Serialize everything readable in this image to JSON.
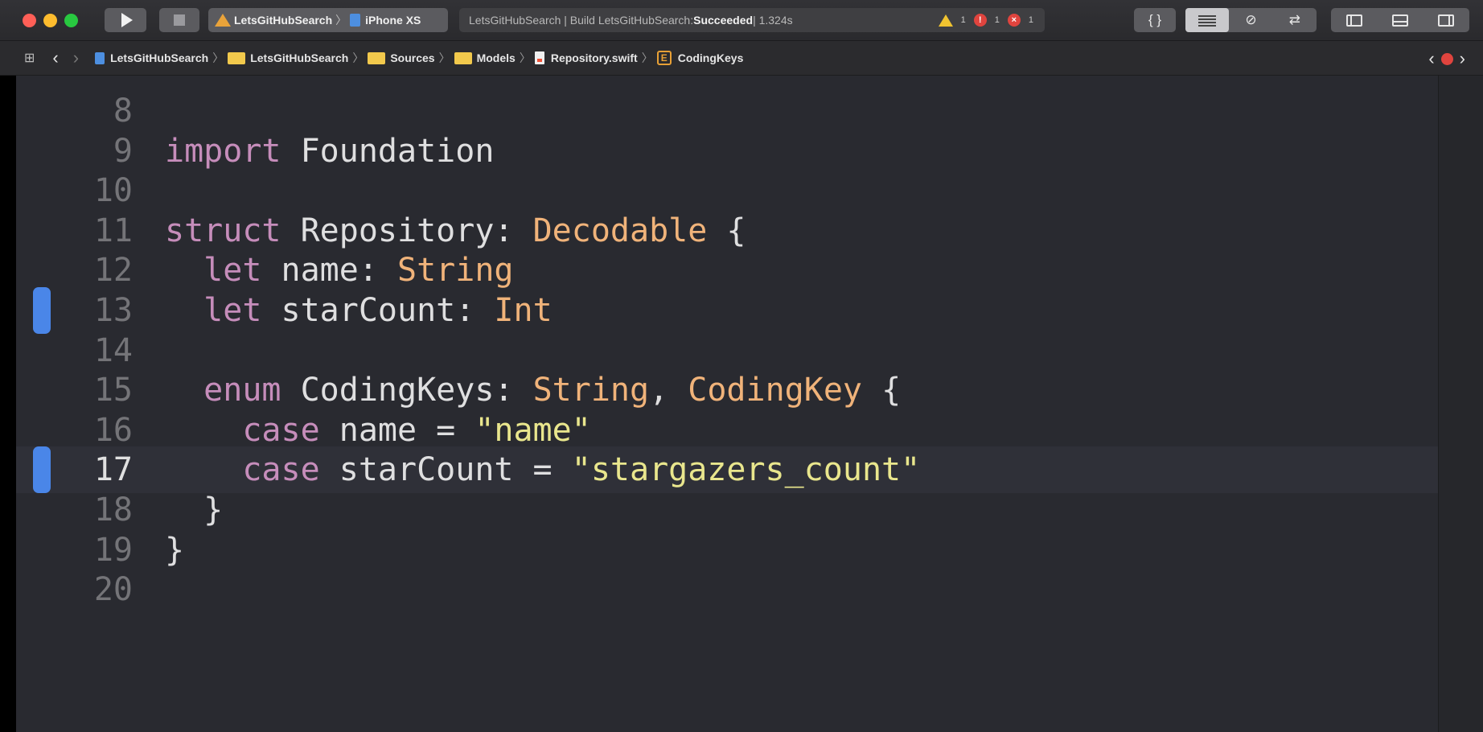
{
  "toolbar": {
    "scheme": {
      "target": "LetsGitHubSearch",
      "device": "iPhone XS"
    },
    "activity": {
      "prefix": "LetsGitHubSearch | Build LetsGitHubSearch: ",
      "status": "Succeeded",
      "suffix": " | 1.324s",
      "warning_count": "1",
      "issue_count": "1",
      "error_count": "1"
    },
    "braces_label": "{ }"
  },
  "jumpbar": {
    "crumbs": [
      "LetsGitHubSearch",
      "LetsGitHubSearch",
      "Sources",
      "Models",
      "Repository.swift",
      "CodingKeys"
    ],
    "enum_badge": "E"
  },
  "editor": {
    "lines": [
      {
        "num": "8",
        "tokens": []
      },
      {
        "num": "9",
        "tokens": [
          [
            "kw",
            "import"
          ],
          [
            "pl",
            " Foundation"
          ]
        ]
      },
      {
        "num": "10",
        "tokens": []
      },
      {
        "num": "11",
        "tokens": [
          [
            "kw",
            "struct"
          ],
          [
            "pl",
            " Repository: "
          ],
          [
            "ty",
            "Decodable"
          ],
          [
            "pl",
            " {"
          ]
        ]
      },
      {
        "num": "12",
        "tokens": [
          [
            "pl",
            "  "
          ],
          [
            "kw",
            "let"
          ],
          [
            "pl",
            " name: "
          ],
          [
            "ty",
            "String"
          ]
        ]
      },
      {
        "num": "13",
        "tokens": [
          [
            "pl",
            "  "
          ],
          [
            "kw",
            "let"
          ],
          [
            "pl",
            " starCount: "
          ],
          [
            "ty",
            "Int"
          ]
        ],
        "changed": true
      },
      {
        "num": "14",
        "tokens": []
      },
      {
        "num": "15",
        "tokens": [
          [
            "pl",
            "  "
          ],
          [
            "kw",
            "enum"
          ],
          [
            "pl",
            " CodingKeys: "
          ],
          [
            "ty",
            "String"
          ],
          [
            "pl",
            ", "
          ],
          [
            "ty",
            "CodingKey"
          ],
          [
            "pl",
            " {"
          ]
        ]
      },
      {
        "num": "16",
        "tokens": [
          [
            "pl",
            "    "
          ],
          [
            "kw",
            "case"
          ],
          [
            "pl",
            " name = "
          ],
          [
            "str",
            "\"name\""
          ]
        ]
      },
      {
        "num": "17",
        "tokens": [
          [
            "pl",
            "    "
          ],
          [
            "kw",
            "case"
          ],
          [
            "pl",
            " starCount = "
          ],
          [
            "str",
            "\"stargazers_count\""
          ]
        ],
        "changed": true,
        "current": true
      },
      {
        "num": "18",
        "tokens": [
          [
            "pl",
            "  }"
          ]
        ]
      },
      {
        "num": "19",
        "tokens": [
          [
            "pl",
            "}"
          ]
        ]
      },
      {
        "num": "20",
        "tokens": []
      }
    ]
  }
}
